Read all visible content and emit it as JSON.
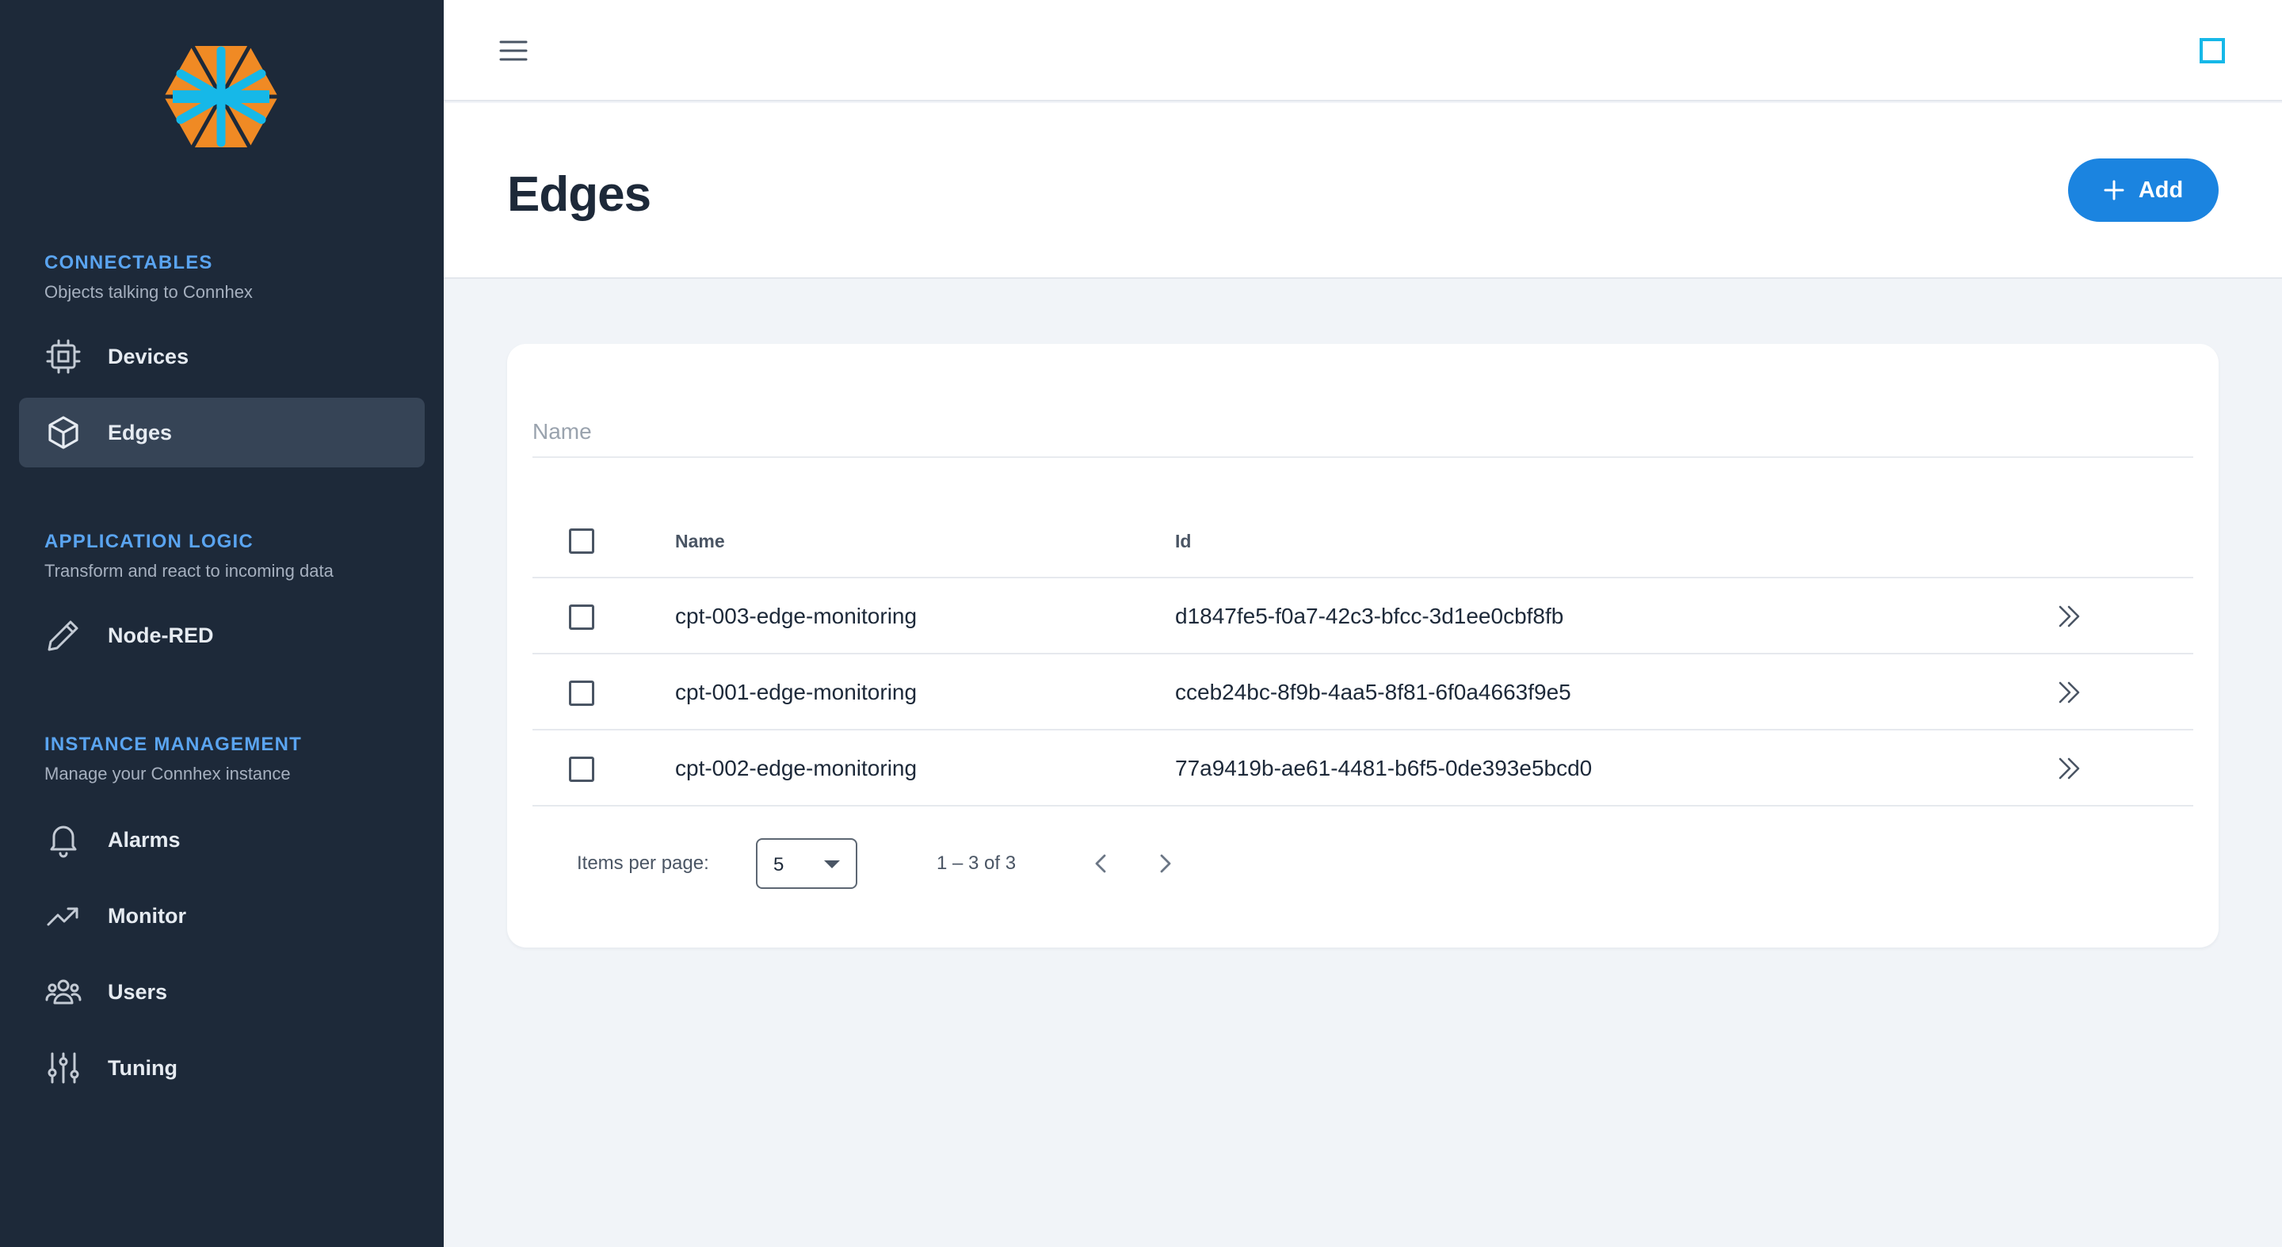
{
  "sidebar": {
    "sections": [
      {
        "title": "CONNECTABLES",
        "subtitle": "Objects talking to Connhex",
        "items": [
          {
            "label": "Devices",
            "icon": "chip-icon"
          },
          {
            "label": "Edges",
            "icon": "cube-icon",
            "active": true
          }
        ]
      },
      {
        "title": "APPLICATION LOGIC",
        "subtitle": "Transform and react to incoming data",
        "items": [
          {
            "label": "Node-RED",
            "icon": "pencil-icon"
          }
        ]
      },
      {
        "title": "INSTANCE MANAGEMENT",
        "subtitle": "Manage your Connhex instance",
        "items": [
          {
            "label": "Alarms",
            "icon": "bell-icon"
          },
          {
            "label": "Monitor",
            "icon": "trending-up-icon"
          },
          {
            "label": "Users",
            "icon": "users-icon"
          },
          {
            "label": "Tuning",
            "icon": "sliders-icon"
          }
        ]
      }
    ]
  },
  "header": {
    "title": "Edges",
    "add_label": "Add"
  },
  "filter": {
    "placeholder": "Name"
  },
  "table": {
    "columns": {
      "name": "Name",
      "id": "Id"
    },
    "rows": [
      {
        "name": "cpt-003-edge-monitoring",
        "id": "d1847fe5-f0a7-42c3-bfcc-3d1ee0cbf8fb"
      },
      {
        "name": "cpt-001-edge-monitoring",
        "id": "cceb24bc-8f9b-4aa5-8f81-6f0a4663f9e5"
      },
      {
        "name": "cpt-002-edge-monitoring",
        "id": "77a9419b-ae61-4481-b6f5-0de393e5bcd0"
      }
    ]
  },
  "paginator": {
    "items_per_page_label": "Items per page:",
    "items_per_page": "5",
    "range": "1 – 3 of 3"
  },
  "colors": {
    "sidebar_bg": "#1d2939",
    "accent": "#1b84e0",
    "section_title": "#5aa4f0",
    "logo_orange": "#f08a24",
    "logo_cyan": "#16b8e8"
  }
}
